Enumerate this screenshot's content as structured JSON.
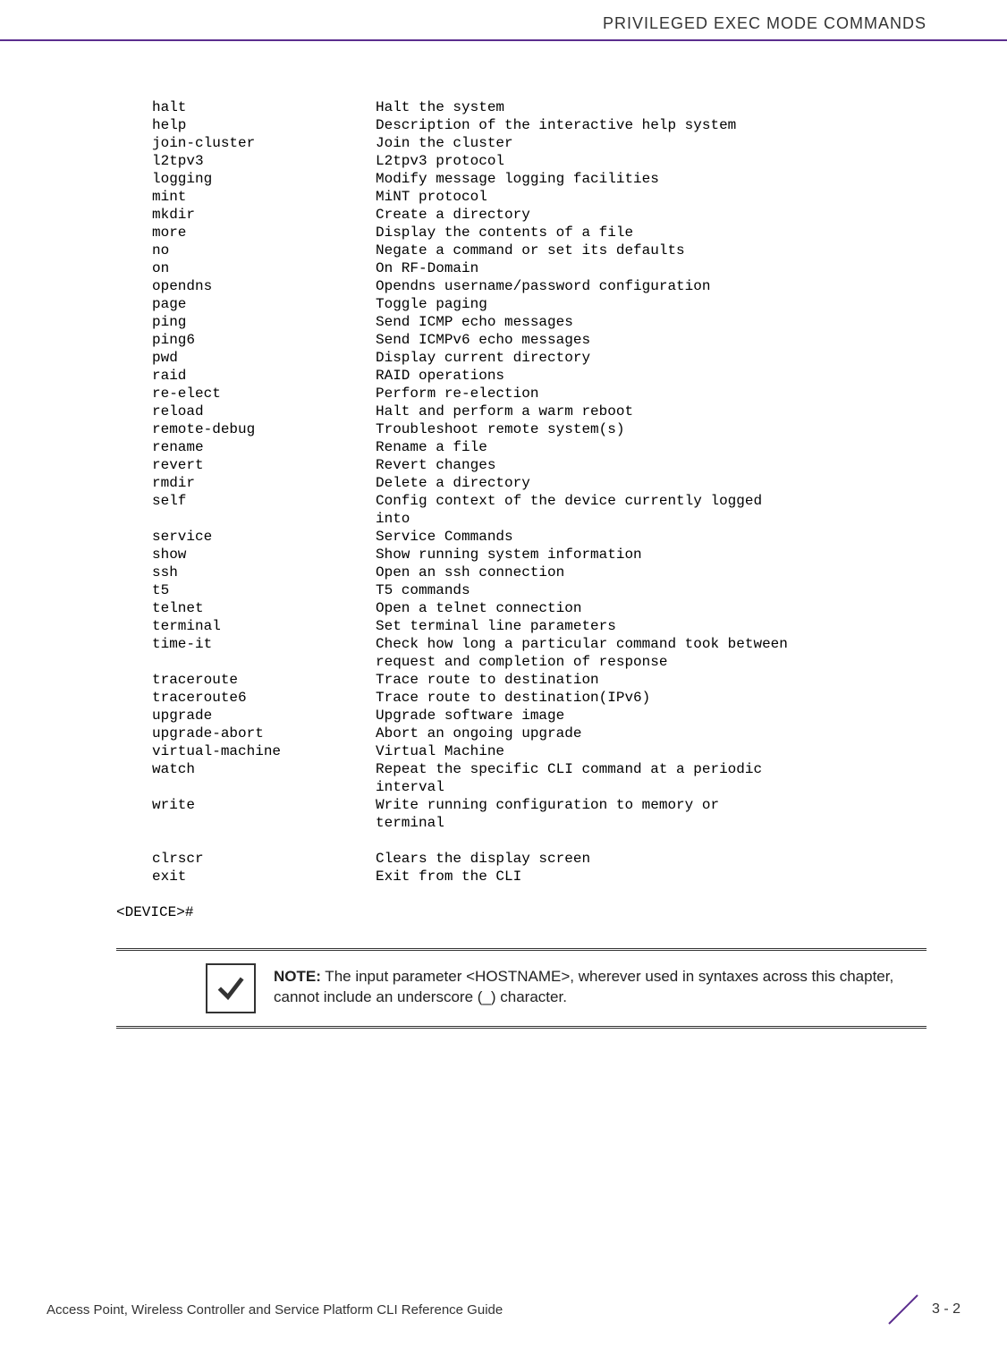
{
  "header": {
    "title": "PRIVILEGED EXEC MODE COMMANDS"
  },
  "commands": [
    {
      "cmd": "halt",
      "desc": "Halt the system"
    },
    {
      "cmd": "help",
      "desc": "Description of the interactive help system"
    },
    {
      "cmd": "join-cluster",
      "desc": "Join the cluster"
    },
    {
      "cmd": "l2tpv3",
      "desc": "L2tpv3 protocol"
    },
    {
      "cmd": "logging",
      "desc": "Modify message logging facilities"
    },
    {
      "cmd": "mint",
      "desc": "MiNT protocol"
    },
    {
      "cmd": "mkdir",
      "desc": "Create a directory"
    },
    {
      "cmd": "more",
      "desc": "Display the contents of a file"
    },
    {
      "cmd": "no",
      "desc": "Negate a command or set its defaults"
    },
    {
      "cmd": "on",
      "desc": "On RF-Domain"
    },
    {
      "cmd": "opendns",
      "desc": "Opendns username/password configuration"
    },
    {
      "cmd": "page",
      "desc": "Toggle paging"
    },
    {
      "cmd": "ping",
      "desc": "Send ICMP echo messages"
    },
    {
      "cmd": "ping6",
      "desc": "Send ICMPv6 echo messages"
    },
    {
      "cmd": "pwd",
      "desc": "Display current directory"
    },
    {
      "cmd": "raid",
      "desc": "RAID operations"
    },
    {
      "cmd": "re-elect",
      "desc": "Perform re-election"
    },
    {
      "cmd": "reload",
      "desc": "Halt and perform a warm reboot"
    },
    {
      "cmd": "remote-debug",
      "desc": "Troubleshoot remote system(s)"
    },
    {
      "cmd": "rename",
      "desc": "Rename a file"
    },
    {
      "cmd": "revert",
      "desc": "Revert changes"
    },
    {
      "cmd": "rmdir",
      "desc": "Delete a directory"
    },
    {
      "cmd": "self",
      "desc": "Config context of the device currently logged",
      "cont": "into"
    },
    {
      "cmd": "service",
      "desc": "Service Commands"
    },
    {
      "cmd": "show",
      "desc": "Show running system information"
    },
    {
      "cmd": "ssh",
      "desc": "Open an ssh connection"
    },
    {
      "cmd": "t5",
      "desc": "T5 commands"
    },
    {
      "cmd": "telnet",
      "desc": "Open a telnet connection"
    },
    {
      "cmd": "terminal",
      "desc": "Set terminal line parameters"
    },
    {
      "cmd": "time-it",
      "desc": "Check how long a particular command took between",
      "cont": "request and completion of response"
    },
    {
      "cmd": "traceroute",
      "desc": "Trace route to destination"
    },
    {
      "cmd": "traceroute6",
      "desc": "Trace route to destination(IPv6)"
    },
    {
      "cmd": "upgrade",
      "desc": "Upgrade software image"
    },
    {
      "cmd": "upgrade-abort",
      "desc": "Abort an ongoing upgrade"
    },
    {
      "cmd": "virtual-machine",
      "desc": "Virtual Machine"
    },
    {
      "cmd": "watch",
      "desc": "Repeat the specific CLI command at a periodic",
      "cont": "interval"
    },
    {
      "cmd": "write",
      "desc": "Write running configuration to memory or",
      "cont": "terminal"
    }
  ],
  "commands2": [
    {
      "cmd": "clrscr",
      "desc": "Clears the display screen"
    },
    {
      "cmd": "exit",
      "desc": "Exit from the CLI"
    }
  ],
  "prompt": "<DEVICE>#",
  "note": {
    "label": "NOTE:",
    "text": " The input parameter <HOSTNAME>, wherever used in syntaxes across this chapter, cannot include an underscore (_) character."
  },
  "footer": {
    "left": "Access Point, Wireless Controller and Service Platform CLI Reference Guide",
    "page": "3 - 2"
  }
}
